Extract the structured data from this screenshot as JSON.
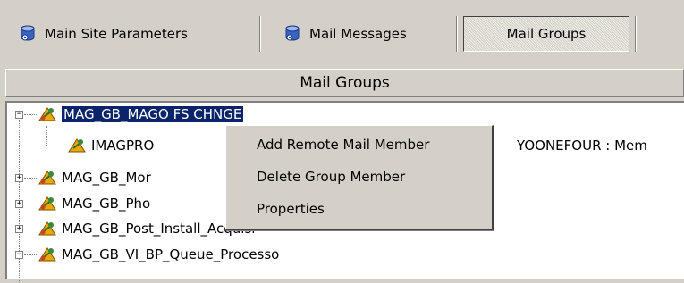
{
  "toolbar": {
    "buttons": [
      {
        "label": "Main Site Parameters",
        "icon": "database-icon"
      },
      {
        "label": "Mail Messages",
        "icon": "database-icon"
      },
      {
        "label": "Mail Groups",
        "icon": "",
        "pressed": true
      }
    ]
  },
  "header": {
    "title": "Mail Groups"
  },
  "tree": {
    "nodes": [
      {
        "label": "MAG_GB_MAGO FS CHNGE",
        "expanded": true,
        "selected": true,
        "icon": "mail-group-icon"
      },
      {
        "label": "IMAGPRO",
        "child": true,
        "icon": "mail-member-icon",
        "suffix": "YOONEFOUR : Mem"
      },
      {
        "label": "MAG_GB_Mor",
        "expanded": false,
        "icon": "mail-group-icon"
      },
      {
        "label": "MAG_GB_Pho",
        "expanded": false,
        "icon": "mail-group-icon"
      },
      {
        "label": "MAG_GB_Post_Install_Acquisi",
        "expanded": false,
        "icon": "mail-group-icon"
      },
      {
        "label": "MAG_GB_VI_BP_Queue_Processo",
        "expanded": true,
        "icon": "mail-group-icon"
      }
    ]
  },
  "context_menu": {
    "items": [
      {
        "label": "Add Remote Mail Member"
      },
      {
        "label": "Delete Group Member"
      },
      {
        "label": "Properties"
      }
    ]
  },
  "colors": {
    "face": "#d4d0c8",
    "selection": "#0a246a",
    "tree_bg": "#ffffff"
  }
}
